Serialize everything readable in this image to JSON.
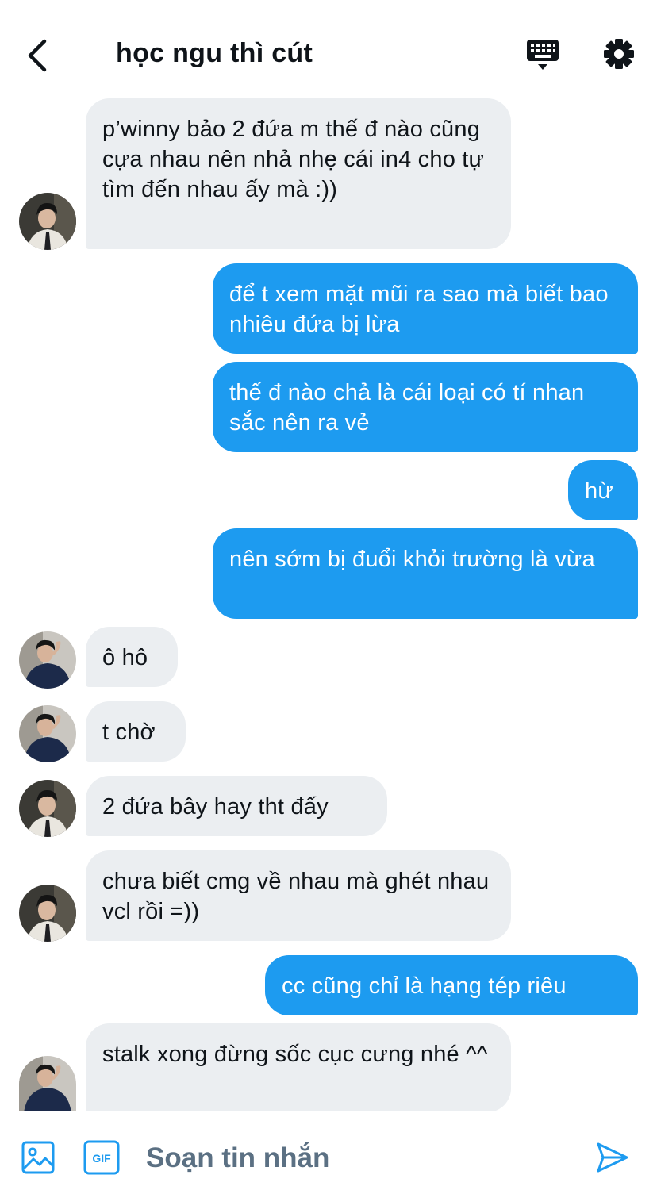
{
  "header": {
    "title": "học ngu thì cút",
    "back_icon": "chevron-left-icon",
    "keyboard_icon": "keyboard-icon",
    "settings_icon": "gear-icon"
  },
  "messages": [
    {
      "direction": "in",
      "text": "p’winny bảo 2 đứa m thế đ nào cũng cựa nhau nên nhả nhẹ cái in4 cho tự tìm đến nhau ấy mà :))"
    },
    {
      "direction": "out",
      "text": "để t xem mặt mũi ra sao mà biết bao nhiêu đứa bị lừa"
    },
    {
      "direction": "out",
      "text": "thế đ nào chả là cái loại có tí nhan sắc nên ra vẻ"
    },
    {
      "direction": "out",
      "text": "hừ"
    },
    {
      "direction": "out",
      "text": "nên sớm bị đuổi khỏi trường là vừa"
    },
    {
      "direction": "in",
      "text": "ô hô"
    },
    {
      "direction": "in",
      "text": "t chờ"
    },
    {
      "direction": "in",
      "text": "2 đứa bây hay tht đấy"
    },
    {
      "direction": "in",
      "text": "chưa biết cmg về nhau mà ghét nhau vcl rồi =))"
    },
    {
      "direction": "out",
      "text": "cc cũng chỉ là hạng tép riêu"
    },
    {
      "direction": "in",
      "text": "stalk xong đừng sốc cục cưng nhé ^^"
    }
  ],
  "composer": {
    "placeholder": "Soạn tin nhắn",
    "value": "",
    "image_icon": "image-icon",
    "gif_icon": "gif-icon",
    "gif_label": "GIF",
    "send_icon": "send-icon"
  },
  "colors": {
    "accent": "#1d9bf0",
    "incoming_bubble": "#ebeef1",
    "text": "#0f1419",
    "placeholder": "#5b7083"
  }
}
